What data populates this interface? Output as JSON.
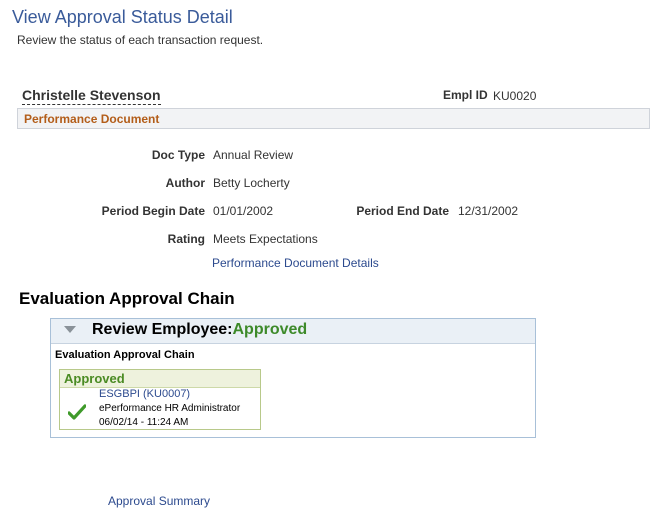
{
  "page": {
    "title": "View Approval Status Detail",
    "description": "Review the status of each transaction request."
  },
  "employee": {
    "name": "Christelle Stevenson",
    "empl_id_label": "Empl ID",
    "empl_id": "KU0020"
  },
  "document": {
    "section_title": "Performance Document",
    "doc_type_label": "Doc Type",
    "doc_type": "Annual Review",
    "author_label": "Author",
    "author": "Betty Locherty",
    "period_begin_label": "Period Begin Date",
    "period_begin": "01/01/2002",
    "period_end_label": "Period End Date",
    "period_end": "12/31/2002",
    "rating_label": "Rating",
    "rating": "Meets Expectations",
    "details_link": "Performance Document Details"
  },
  "approval_chain": {
    "title": "Evaluation Approval Chain",
    "header_label": "Review Employee:",
    "header_status": "Approved",
    "sub_title": "Evaluation Approval Chain",
    "approver": {
      "status": "Approved",
      "name": "ESGBPI (KU0007)",
      "role": "ePerformance HR Administrator",
      "datetime": "06/02/14 - 11:24 AM"
    }
  },
  "footer": {
    "summary_link": "Approval Summary"
  },
  "colors": {
    "title_blue": "#3a5b9a",
    "section_orange": "#b35d19",
    "approved_green": "#4a8b23",
    "link_blue": "#2c4a8e"
  }
}
